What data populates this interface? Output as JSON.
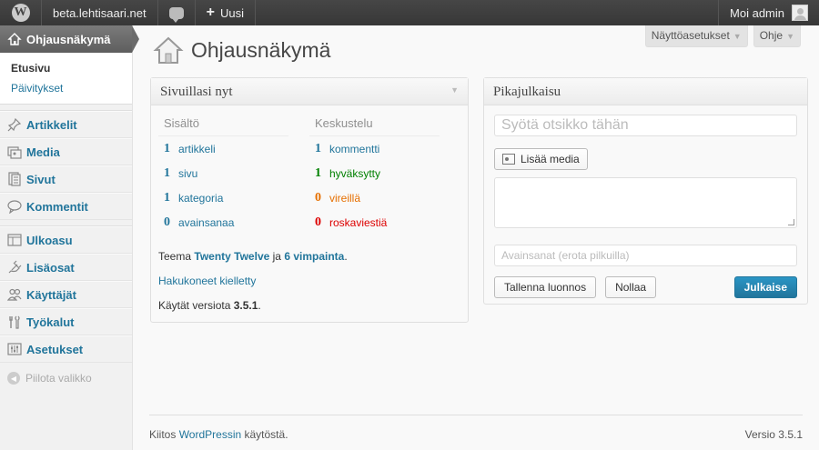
{
  "adminbar": {
    "site_name": "beta.lehtisaari.net",
    "new_label": "Uusi",
    "account_label": "Moi admin"
  },
  "sidebar": {
    "dashboard_label": "Ohjausnäkymä",
    "submenu": [
      "Etusivu",
      "Päivitykset"
    ],
    "group1": [
      "Artikkelit",
      "Media",
      "Sivut",
      "Kommentit"
    ],
    "group2": [
      "Ulkoasu",
      "Lisäosat",
      "Käyttäjät",
      "Työkalut",
      "Asetukset"
    ],
    "collapse_label": "Piilota valikko"
  },
  "screen_tabs": {
    "screen_options": "Näyttöasetukset",
    "help": "Ohje"
  },
  "page_title": "Ohjausnäkymä",
  "right_now": {
    "title": "Sivuillasi nyt",
    "content_header": "Sisältö",
    "discussion_header": "Keskustelu",
    "content_rows": [
      {
        "num": "1",
        "label": "artikkeli"
      },
      {
        "num": "1",
        "label": "sivu"
      },
      {
        "num": "1",
        "label": "kategoria"
      },
      {
        "num": "0",
        "label": "avainsanaa"
      }
    ],
    "discussion_rows": [
      {
        "num": "1",
        "label": "kommentti"
      },
      {
        "num": "1",
        "label": "hyväksytty"
      },
      {
        "num": "0",
        "label": "vireillä"
      },
      {
        "num": "0",
        "label": "roskaviestiä"
      }
    ],
    "theme_prefix": "Teema",
    "theme_name": "Twenty Twelve",
    "theme_mid": "ja",
    "widgets_link": "6 vimpainta",
    "theme_suffix": ".",
    "search_engines": "Hakukoneet kielletty",
    "version_prefix": "Käytät versiota",
    "version": "3.5.1",
    "version_suffix": "."
  },
  "quickpress": {
    "title": "Pikajulkaisu",
    "title_placeholder": "Syötä otsikko tähän",
    "add_media": "Lisää media",
    "tags_placeholder": "Avainsanat (erota pilkuilla)",
    "save_draft": "Tallenna luonnos",
    "reset": "Nollaa",
    "publish": "Julkaise"
  },
  "footer": {
    "thanks_prefix": "Kiitos",
    "thanks_link": "WordPressin",
    "thanks_suffix": "käytöstä.",
    "version": "Versio 3.5.1"
  },
  "colors": {
    "link": "#21759b",
    "approved": "#008000",
    "pending": "#e66f00",
    "spam": "#dd0000",
    "primary_button": "#21759b"
  }
}
